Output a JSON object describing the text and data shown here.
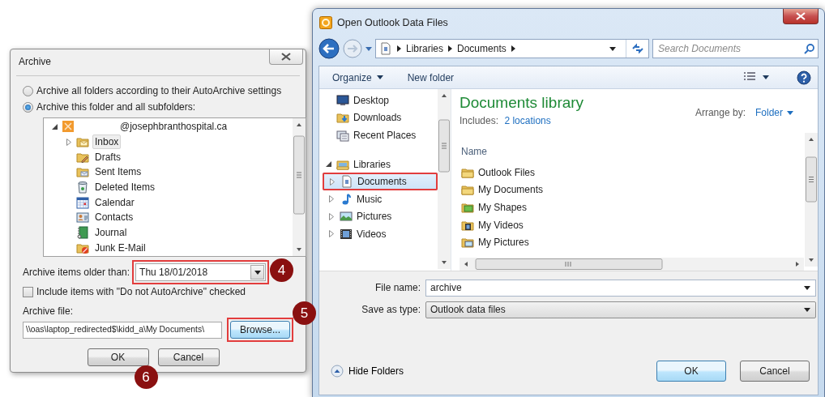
{
  "archive_dialog": {
    "title": "Archive",
    "scope_options": [
      {
        "label": "Archive all folders according to their AutoArchive settings",
        "selected": false
      },
      {
        "label": "Archive this folder and all subfolders:",
        "selected": true
      }
    ],
    "folder_tree": {
      "label": "@josephbranthospital.ca",
      "expanded": true,
      "children": [
        {
          "label": "Inbox",
          "kind": "inbox",
          "selected": true,
          "has_subfolders": true
        },
        {
          "label": "Drafts",
          "kind": "drafts",
          "selected": false,
          "has_subfolders": false
        },
        {
          "label": "Sent Items",
          "kind": "sent",
          "selected": false,
          "has_subfolders": false
        },
        {
          "label": "Deleted Items",
          "kind": "deleted",
          "selected": false,
          "has_subfolders": false
        },
        {
          "label": "Calendar",
          "kind": "calendar",
          "selected": false,
          "has_subfolders": false
        },
        {
          "label": "Contacts",
          "kind": "contacts",
          "selected": false,
          "has_subfolders": false
        },
        {
          "label": "Journal",
          "kind": "journal",
          "selected": false,
          "has_subfolders": false
        },
        {
          "label": "Junk E-Mail",
          "kind": "junk",
          "selected": false,
          "has_subfolders": false
        }
      ]
    },
    "older_than": {
      "label": "Archive items older than:",
      "value": "Thu 18/01/2018",
      "highlighted": true,
      "callout": "4"
    },
    "include_option": {
      "label": "Include items with \"Do not AutoArchive\" checked",
      "checked": false
    },
    "archive_file": {
      "label": "Archive file:",
      "value": "\\\\oas\\laptop_redirected$\\kidd_a\\My Documents\\"
    },
    "browse_button": {
      "label": "Browse...",
      "highlighted": true,
      "callout": "5"
    },
    "buttons": [
      {
        "label": "OK",
        "callout": "6"
      },
      {
        "label": "Cancel"
      }
    ]
  },
  "open_dialog": {
    "title": "Open Outlook Data Files",
    "breadcrumb": [
      "Libraries",
      "Documents"
    ],
    "search": {
      "placeholder": "Search Documents"
    },
    "toolbar": [
      {
        "label": "Organize",
        "dropdown": true
      },
      {
        "label": "New folder",
        "dropdown": false
      }
    ],
    "nav": [
      {
        "label": "Desktop",
        "kind": "desktop",
        "selected": false
      },
      {
        "label": "Downloads",
        "kind": "downloads",
        "selected": false
      },
      {
        "label": "Recent Places",
        "kind": "recent",
        "selected": false
      },
      {
        "label": "Libraries",
        "kind": "libraries",
        "selected": false,
        "expanded": true,
        "children": [
          {
            "label": "Documents",
            "kind": "documents",
            "selected": true,
            "expanded": false,
            "highlighted": true
          },
          {
            "label": "Music",
            "kind": "music",
            "selected": false,
            "expanded": false,
            "highlighted": false
          },
          {
            "label": "Pictures",
            "kind": "pictures",
            "selected": false,
            "expanded": false,
            "highlighted": false
          },
          {
            "label": "Videos",
            "kind": "videos",
            "selected": false,
            "expanded": false,
            "highlighted": false
          }
        ]
      }
    ],
    "library": {
      "title": "Documents library",
      "includes_label": "Includes:",
      "includes_link": "2 locations",
      "arrange_label": "Arrange by:",
      "arrange_value": "Folder"
    },
    "columns": [
      "Name"
    ],
    "files": [
      {
        "name": "Outlook Files",
        "kind": "folder"
      },
      {
        "name": "My Documents",
        "kind": "folder"
      },
      {
        "name": "My Shapes",
        "kind": "shapes"
      },
      {
        "name": "My Videos",
        "kind": "video_folder"
      },
      {
        "name": "My Pictures",
        "kind": "picture_folder"
      }
    ],
    "file_name": {
      "label": "File name:",
      "value": "archive"
    },
    "save_type": {
      "label": "Save as type:",
      "value": "Outlook data files"
    },
    "hide_folders": "Hide Folders",
    "buttons": [
      {
        "label": "OK",
        "default": true
      },
      {
        "label": "Cancel",
        "default": false
      }
    ]
  }
}
